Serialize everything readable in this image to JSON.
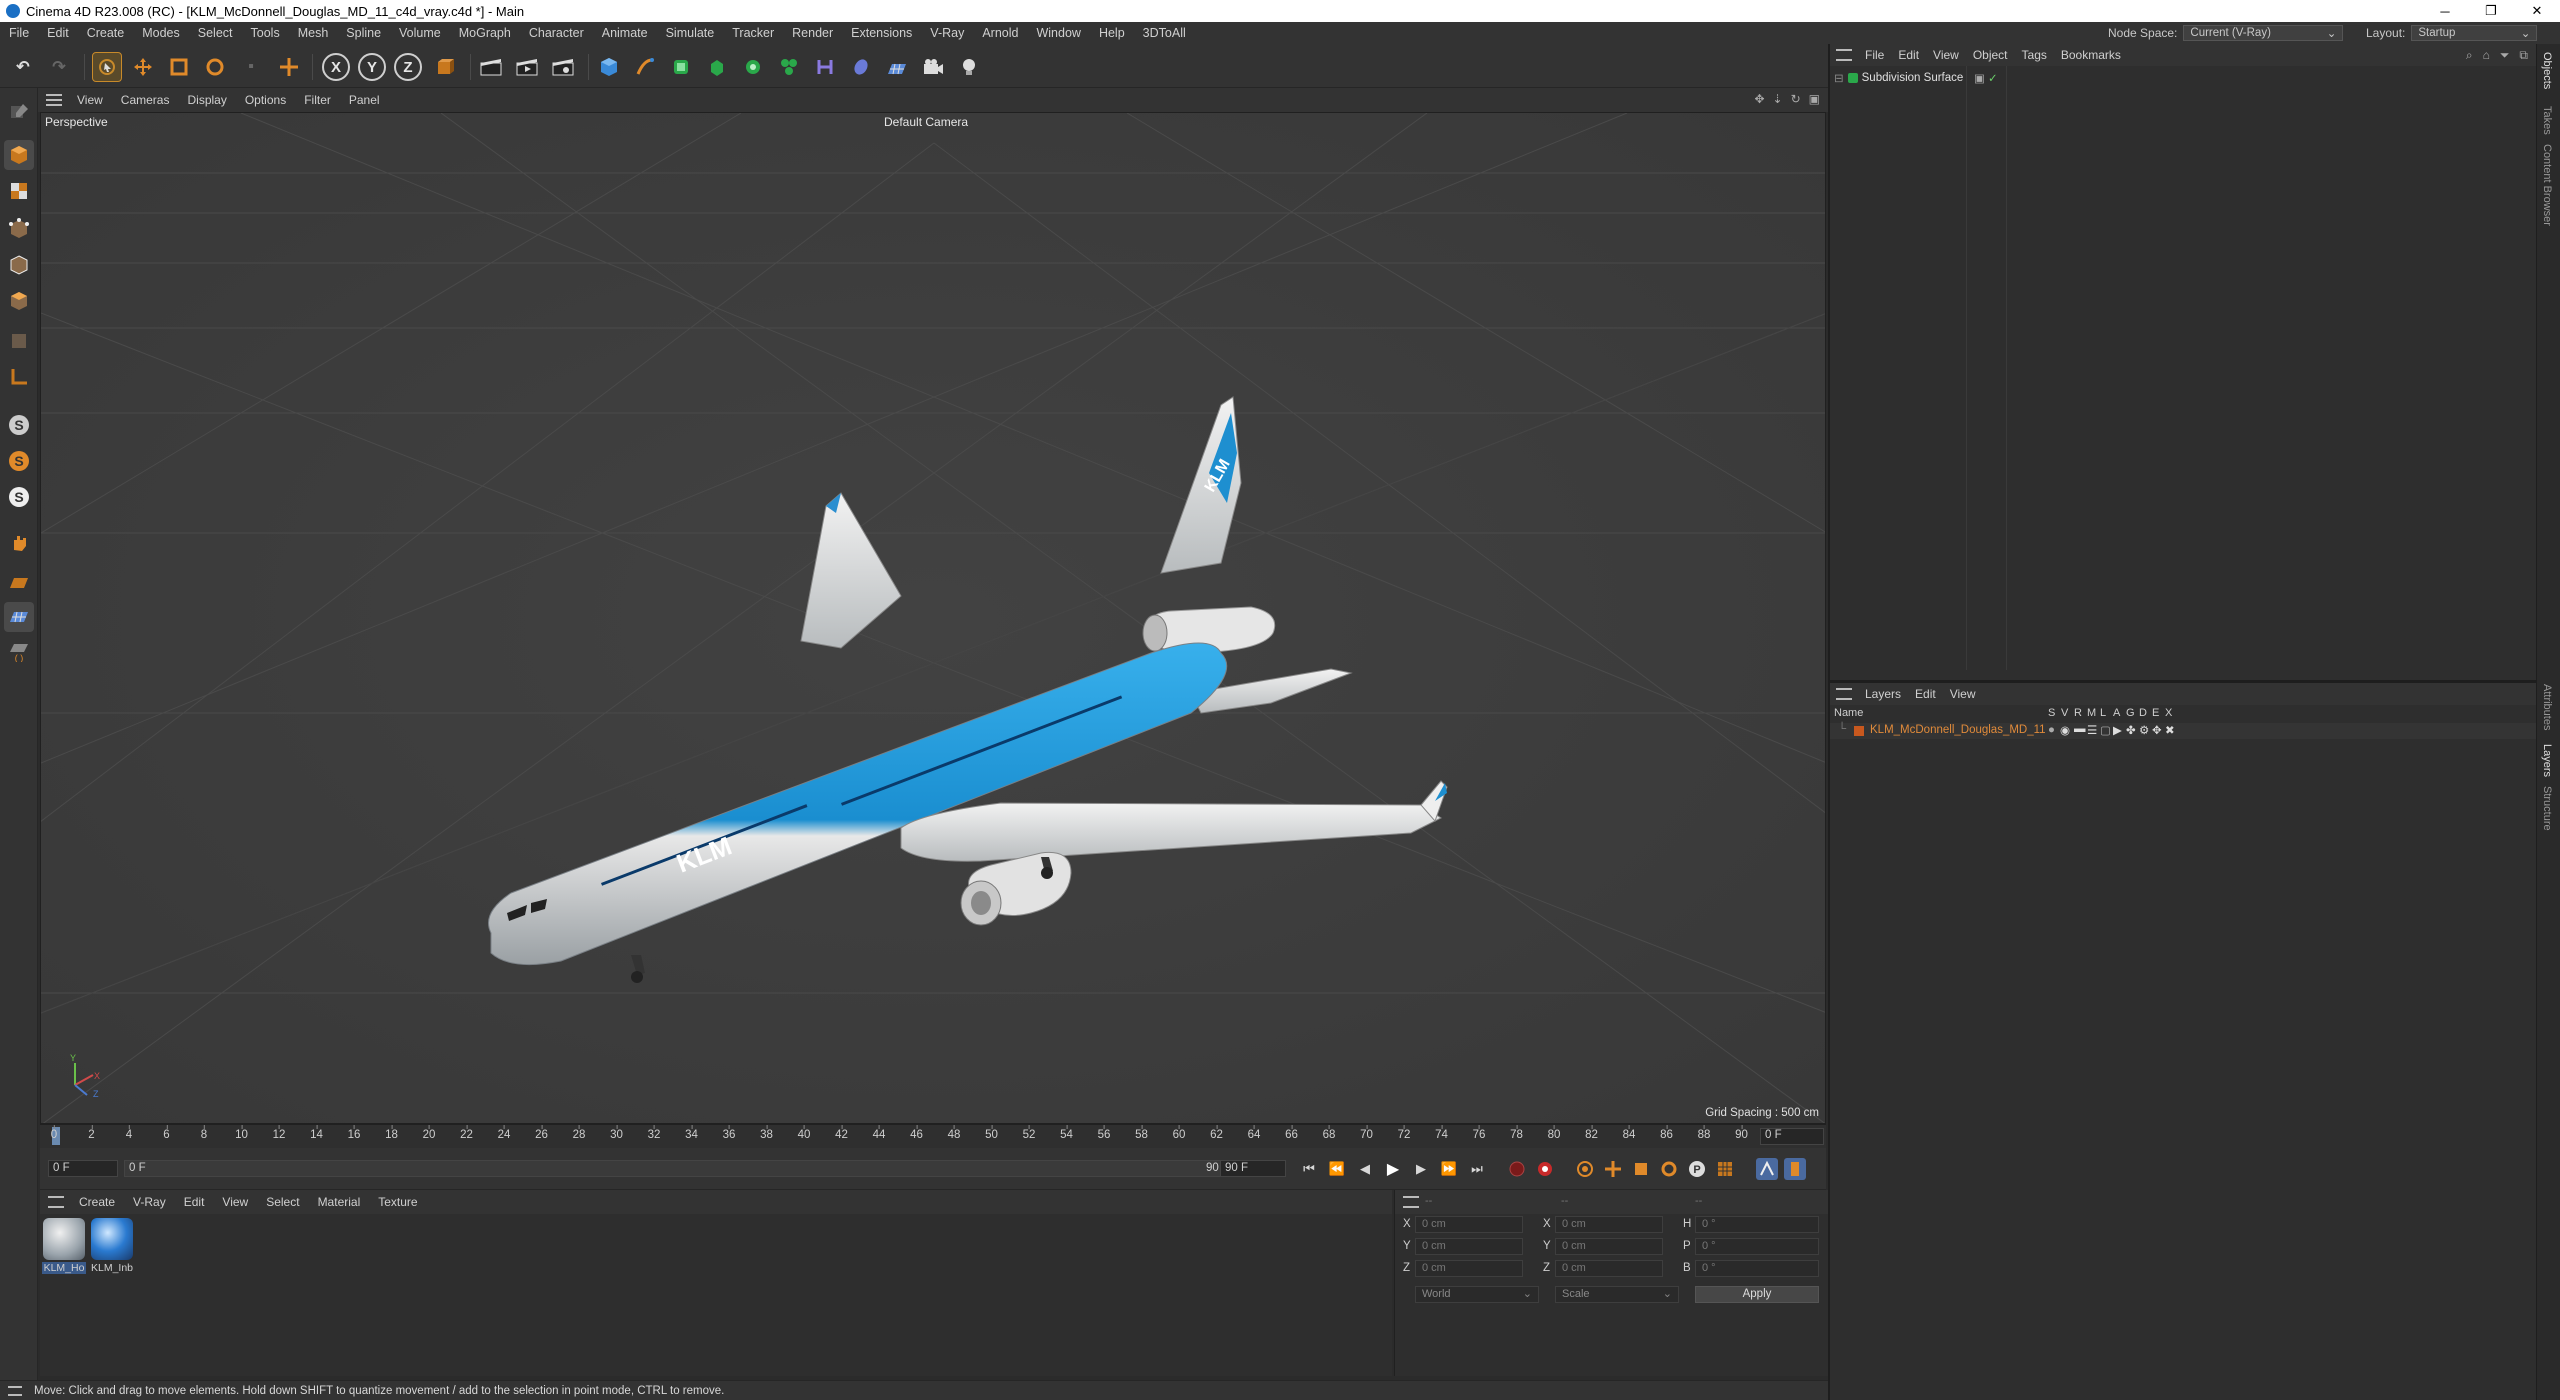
{
  "window": {
    "title": "Cinema 4D R23.008 (RC) - [KLM_McDonnell_Douglas_MD_11_c4d_vray.c4d *] - Main",
    "controls": [
      "─",
      "❐",
      "✕"
    ]
  },
  "menubar": {
    "items": [
      "File",
      "Edit",
      "Create",
      "Modes",
      "Select",
      "Tools",
      "Mesh",
      "Spline",
      "Volume",
      "MoGraph",
      "Character",
      "Animate",
      "Simulate",
      "Tracker",
      "Render",
      "Extensions",
      "V-Ray",
      "Arnold",
      "Window",
      "Help",
      "3DToAll"
    ],
    "node_space_label": "Node Space:",
    "node_space_value": "Current (V-Ray)",
    "layout_label": "Layout:",
    "layout_value": "Startup"
  },
  "toolbar": {
    "axis_x": "X",
    "axis_y": "Y",
    "axis_z": "Z"
  },
  "viewport": {
    "menu": [
      "View",
      "Cameras",
      "Display",
      "Options",
      "Filter",
      "Panel"
    ],
    "label": "Perspective",
    "camera": "Default Camera",
    "grid_spacing": "Grid Spacing : 500 cm",
    "axis_y": "Y",
    "axis_x": "X",
    "axis_z": "Z",
    "aircraft_livery": "KLM"
  },
  "timeline": {
    "ticks": [
      "0",
      "2",
      "4",
      "6",
      "8",
      "10",
      "12",
      "14",
      "16",
      "18",
      "20",
      "22",
      "24",
      "26",
      "28",
      "30",
      "32",
      "34",
      "36",
      "38",
      "40",
      "42",
      "44",
      "46",
      "48",
      "50",
      "52",
      "54",
      "56",
      "58",
      "60",
      "62",
      "64",
      "66",
      "68",
      "70",
      "72",
      "74",
      "76",
      "78",
      "80",
      "82",
      "84",
      "86",
      "88",
      "90"
    ],
    "current_frame": "0 F"
  },
  "playbar": {
    "start": "0 F",
    "start2": "0 F",
    "end": "90 F",
    "end2": "90 F"
  },
  "materials": {
    "menu": [
      "Create",
      "V-Ray",
      "Edit",
      "View",
      "Select",
      "Material",
      "Texture"
    ],
    "items": [
      {
        "name": "KLM_Ho"
      },
      {
        "name": "KLM_Inb"
      }
    ]
  },
  "coords": {
    "header1": "--",
    "header2": "--",
    "header3": "--",
    "rows": [
      {
        "a": "X",
        "va": "0 cm",
        "b": "X",
        "vb": "0 cm",
        "c": "H",
        "vc": "0 °"
      },
      {
        "a": "Y",
        "va": "0 cm",
        "b": "Y",
        "vb": "0 cm",
        "c": "P",
        "vc": "0 °"
      },
      {
        "a": "Z",
        "va": "0 cm",
        "b": "Z",
        "vb": "0 cm",
        "c": "B",
        "vc": "0 °"
      }
    ],
    "world": "World",
    "scale": "Scale",
    "apply": "Apply"
  },
  "status": {
    "text": "Move: Click and drag to move elements. Hold down SHIFT to quantize movement / add to the selection in point mode, CTRL to remove."
  },
  "objects": {
    "menu": [
      "File",
      "Edit",
      "View",
      "Object",
      "Tags",
      "Bookmarks"
    ],
    "rows": [
      {
        "name": "Subdivision Surface"
      }
    ]
  },
  "layers": {
    "menu": [
      "Layers",
      "Edit",
      "View"
    ],
    "col_name": "Name",
    "col_flags": [
      "S",
      "V",
      "R",
      "M",
      "L",
      "A",
      "G",
      "D",
      "E",
      "X"
    ],
    "rows": [
      {
        "name": "KLM_McDonnell_Douglas_MD_11"
      }
    ]
  },
  "sidetabs": [
    "Objects",
    "Takes",
    "Content Browser",
    "Attributes",
    "Layers",
    "Structure"
  ],
  "colors": {
    "accent_orange": "#c8781e",
    "klm_blue": "#1e8fd0",
    "layer_text": "#e08a3a",
    "active_tab": "#e0e0e0"
  }
}
